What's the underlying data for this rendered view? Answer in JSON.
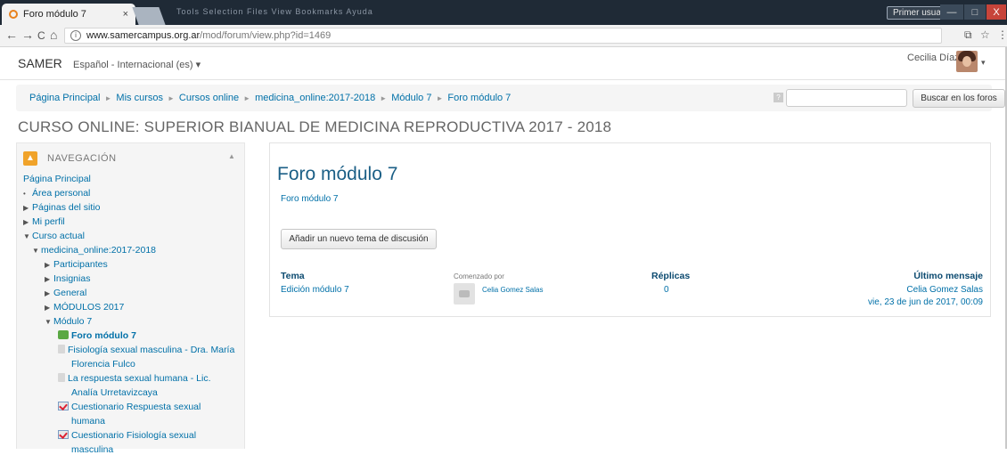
{
  "browser": {
    "tab_title": "Foro módulo 7",
    "tab_close": "×",
    "blurred_menu": "Tools  Selection  Files  View  Bookmarks  Ayuda",
    "user_chip": "Primer usuario",
    "win_min": "—",
    "win_max": "□",
    "win_close": "X",
    "url_domain": "www.samercampus.org.ar",
    "url_path": "/mod/forum/view.php?id=1469",
    "nav_back": "←",
    "nav_forward": "→",
    "nav_reload": "C",
    "nav_home": "⌂",
    "translate_icon": "⧉",
    "star_icon": "☆",
    "menu_icon": "⋮"
  },
  "navbar": {
    "brand": "SAMER",
    "language": "Español - Internacional (es) ▾",
    "user_name": "Cecilia Díaz",
    "user_caret": "▾"
  },
  "breadcrumb": [
    "Página Principal",
    "Mis cursos",
    "Cursos online",
    "medicina_online:2017-2018",
    "Módulo 7",
    "Foro módulo 7"
  ],
  "search": {
    "help": "?",
    "placeholder": "",
    "button": "Buscar en los foros"
  },
  "course_title": "CURSO ONLINE: SUPERIOR BIANUAL DE MEDICINA REPRODUCTIVA 2017 - 2018",
  "navigation": {
    "title": "NAVEGACIÓN",
    "collapse": "▲",
    "items": [
      {
        "label": "Página Principal"
      },
      {
        "label": "Área personal"
      },
      {
        "label": "Páginas del sitio"
      },
      {
        "label": "Mi perfil"
      },
      {
        "label": "Curso actual"
      },
      {
        "label": "medicina_online:2017-2018"
      },
      {
        "label": "Participantes"
      },
      {
        "label": "Insignias"
      },
      {
        "label": "General"
      },
      {
        "label": "MÓDULOS 2017"
      },
      {
        "label": "Módulo 7"
      },
      {
        "label": "Foro módulo 7"
      },
      {
        "label": "Fisiología sexual masculina - Dra. María"
      },
      {
        "label": "Florencia Fulco"
      },
      {
        "label": "La respuesta sexual humana - Lic."
      },
      {
        "label": "Analía Urretavizcaya"
      },
      {
        "label": "Cuestionario Respuesta sexual"
      },
      {
        "label": "humana"
      },
      {
        "label": "Cuestionario Fisiología sexual"
      },
      {
        "label": "masculina"
      }
    ]
  },
  "forum": {
    "heading": "Foro módulo 7",
    "intro": "Foro módulo 7",
    "add_button": "Añadir un nuevo tema de discusión",
    "headers": {
      "topic": "Tema",
      "started_by": "Comenzado por",
      "replies": "Réplicas",
      "last_post": "Último mensaje"
    },
    "rows": [
      {
        "topic": "Edición módulo 7",
        "author": "Celia Gomez Salas",
        "replies": "0",
        "last_author": "Celia Gomez Salas",
        "last_date": "vie, 23 de jun de 2017, 00:09"
      }
    ]
  }
}
